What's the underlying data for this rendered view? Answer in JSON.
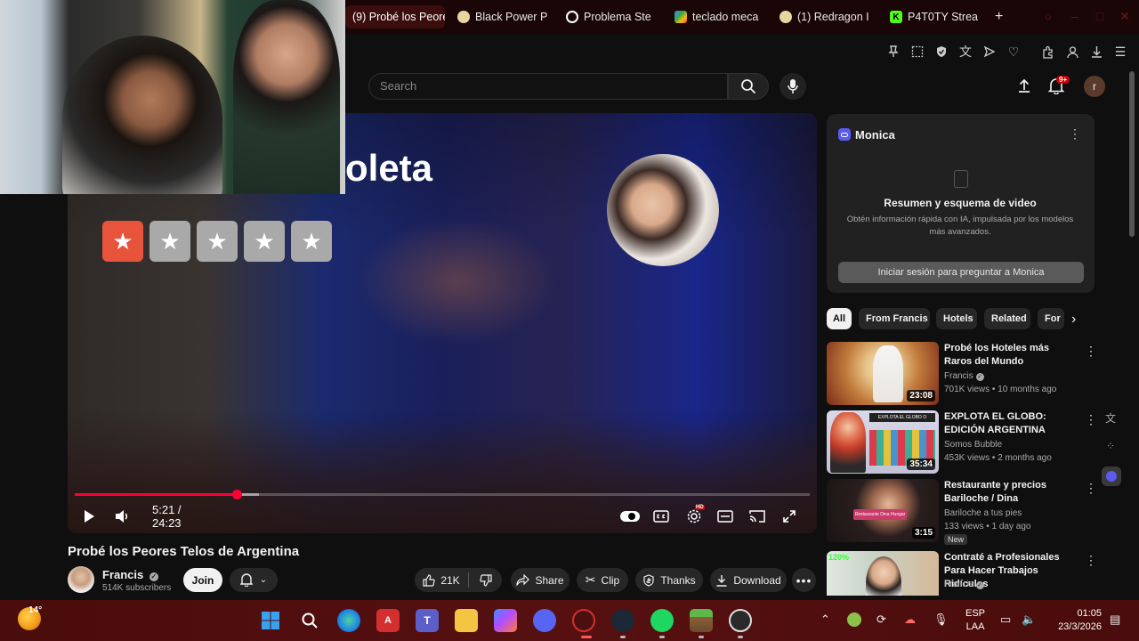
{
  "browser": {
    "tabs": [
      {
        "label": "(9) Probé los Peore",
        "favicon": "youtube-icon",
        "active": true
      },
      {
        "label": "Black Power P",
        "favicon": "bowl-icon"
      },
      {
        "label": "Problema Ste",
        "favicon": "openai-icon"
      },
      {
        "label": "teclado meca",
        "favicon": "store-icon"
      },
      {
        "label": "(1) Redragon I",
        "favicon": "bowl-icon"
      },
      {
        "label": "P4T0TY Strea",
        "favicon": "kick-icon"
      }
    ],
    "new_tab": "+"
  },
  "youtube": {
    "search_placeholder": "Search",
    "notif_count": "9+",
    "avatar_letter": "r"
  },
  "player": {
    "overlay_title": "oleta",
    "rating_filled": 1,
    "rating_max": 5,
    "time": "5:21 / 24:23",
    "played_fraction": 0.22,
    "buffered_fraction": 0.25,
    "hd_badge": "HD"
  },
  "video": {
    "title": "Probé los Peores Telos de Argentina",
    "channel": "Francis",
    "subscribers": "514K subscribers",
    "join": "Join",
    "likes": "21K",
    "share": "Share",
    "clip": "Clip",
    "thanks": "Thanks",
    "download": "Download"
  },
  "monica": {
    "title": "Monica",
    "heading": "Resumen y esquema de video",
    "description": "Obtén información rápida con IA, impulsada por los modelos más avanzados.",
    "button": "Iniciar sesión para preguntar a Monica"
  },
  "chips": [
    "All",
    "From Francis",
    "Hotels",
    "Related",
    "For"
  ],
  "recommendations": [
    {
      "title": "Probé los Hoteles más Raros del Mundo",
      "channel": "Francis",
      "verified": true,
      "meta": "701K views • 10 months ago",
      "duration": "23:08"
    },
    {
      "title": "EXPLOTA EL GLOBO: EDICIÓN ARGENTINA",
      "channel": "Somos Bubble",
      "verified": false,
      "meta": "453K views • 2 months ago",
      "duration": "35:34",
      "thumb_text": "EXPLOTA EL GLOBO O ENCUENTRA EL AMOR"
    },
    {
      "title": "Restaurante y precios Bariloche / Dina",
      "channel": "Bariloche a tus pies",
      "verified": false,
      "meta": "133 views • 1 day ago",
      "duration": "3:15",
      "badge": "New",
      "thumb_text": "Restaurante Dina Hungar"
    },
    {
      "title": "Contraté a Profesionales Para Hacer Trabajos Ridículos",
      "channel": "Francis",
      "verified": true,
      "meta": "",
      "duration": "",
      "thumb_text": "120%"
    }
  ],
  "taskbar": {
    "weather": "14°",
    "lang_top": "ESP",
    "lang_bottom": "LAA",
    "time": "01:05",
    "date": "23/3/2026"
  }
}
